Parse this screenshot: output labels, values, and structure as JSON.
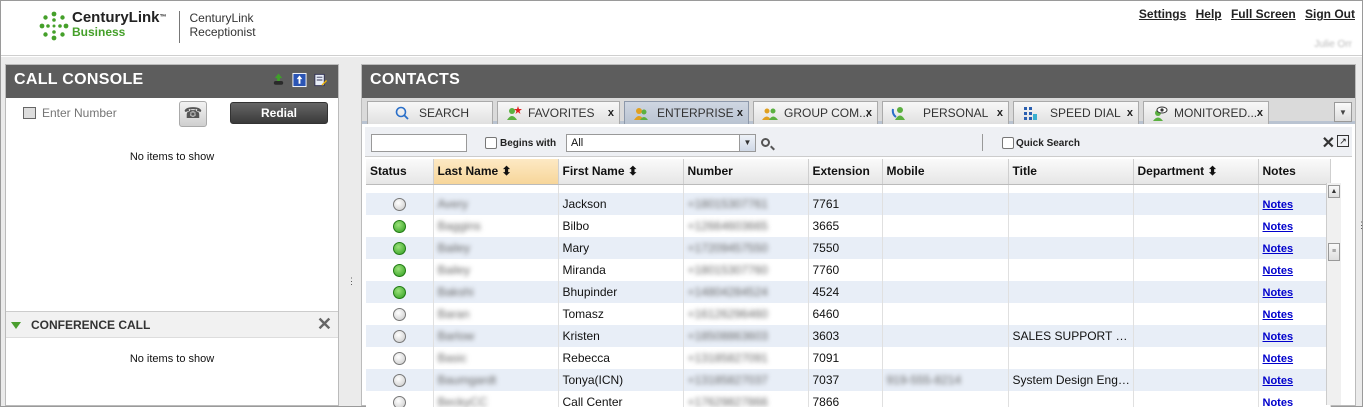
{
  "header": {
    "brand": "CenturyLink",
    "brand_sub": "Business",
    "product_line1": "CenturyLink",
    "product_line2": "Receptionist",
    "links": [
      "Settings",
      "Help",
      "Full Screen",
      "Sign Out"
    ],
    "user": "Julie Orr"
  },
  "call_console": {
    "title": "CALL CONSOLE",
    "number_placeholder": "Enter Number",
    "redial_label": "Redial",
    "empty_text": "No items to show"
  },
  "conference": {
    "title": "CONFERENCE CALL",
    "empty_text": "No items to show"
  },
  "contacts": {
    "title": "CONTACTS",
    "tabs": [
      {
        "label": "SEARCH",
        "icon": "search-icon",
        "closable": false,
        "active": false
      },
      {
        "label": "FAVORITES",
        "icon": "favorites-icon",
        "closable": true,
        "active": false
      },
      {
        "label": "ENTERPRISE",
        "icon": "enterprise-icon",
        "closable": true,
        "active": true
      },
      {
        "label": "GROUP COM...",
        "icon": "group-icon",
        "closable": true,
        "active": false
      },
      {
        "label": "PERSONAL",
        "icon": "personal-icon",
        "closable": true,
        "active": false
      },
      {
        "label": "SPEED DIAL",
        "icon": "speed-dial-icon",
        "closable": true,
        "active": false
      },
      {
        "label": "MONITORED...",
        "icon": "monitored-icon",
        "closable": true,
        "active": false
      }
    ],
    "tab_close_label": "x",
    "toolbar": {
      "begins_with_label": "Begins with",
      "filter_value": "All",
      "quick_search_label": "Quick Search"
    },
    "columns": [
      "Status",
      "Last Name",
      "First Name",
      "Number",
      "Extension",
      "Mobile",
      "Title",
      "Department",
      "Notes"
    ],
    "notes_label": "Notes",
    "rows": [
      {
        "status": "offline",
        "last": "Avery",
        "first": "Jackson",
        "number": "+18015307761",
        "ext": "7761",
        "mobile": "",
        "title": ""
      },
      {
        "status": "available",
        "last": "Baggins",
        "first": "Bilbo",
        "number": "+12664603665",
        "ext": "3665",
        "mobile": "",
        "title": ""
      },
      {
        "status": "available",
        "last": "Bailey",
        "first": "Mary",
        "number": "+17209457550",
        "ext": "7550",
        "mobile": "",
        "title": ""
      },
      {
        "status": "available",
        "last": "Bailey",
        "first": "Miranda",
        "number": "+18015307760",
        "ext": "7760",
        "mobile": "",
        "title": ""
      },
      {
        "status": "available",
        "last": "Bakshi",
        "first": "Bhupinder",
        "number": "+14804284524",
        "ext": "4524",
        "mobile": "",
        "title": ""
      },
      {
        "status": "offline",
        "last": "Baran",
        "first": "Tomasz",
        "number": "+16126296460",
        "ext": "6460",
        "mobile": "",
        "title": ""
      },
      {
        "status": "offline",
        "last": "Barlow",
        "first": "Kristen",
        "number": "+18508863603",
        "ext": "3603",
        "mobile": "",
        "title": "SALES SUPPORT R..."
      },
      {
        "status": "offline",
        "last": "Basic",
        "first": "Rebecca",
        "number": "+13185827091",
        "ext": "7091",
        "mobile": "",
        "title": ""
      },
      {
        "status": "offline",
        "last": "Baumgardt",
        "first": "Tonya(ICN)",
        "number": "+13185827037",
        "ext": "7037",
        "mobile": "919-555-8214",
        "title": "System Design Engin..."
      },
      {
        "status": "offline",
        "last": "BeckyCC",
        "first": "Call Center",
        "number": "+17629827866",
        "ext": "7866",
        "mobile": "",
        "title": ""
      }
    ]
  },
  "colors": {
    "panel_header": "#5d5d5d",
    "row_alt": "#e8eef7",
    "status_available": "#2f9e1f",
    "link": "#0000cc",
    "brand_green": "#45a02a"
  }
}
